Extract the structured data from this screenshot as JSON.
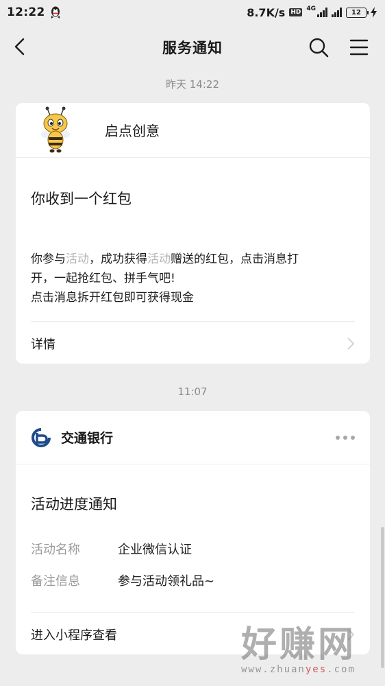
{
  "status_bar": {
    "time": "12:22",
    "network_speed": "8.7K/s",
    "hd_badge": "HD",
    "network_type": "4G",
    "battery_level": "12"
  },
  "nav": {
    "title": "服务通知",
    "back_icon": "chevron-left-icon",
    "search_icon": "search-icon",
    "menu_icon": "menu-icon"
  },
  "timestamps": [
    "昨天 14:22",
    "11:07"
  ],
  "cards": [
    {
      "brand": "启点创意",
      "avatar_icon": "bee-mascot-icon",
      "title": "你收到一个红包",
      "body": {
        "line1_a": "你参与",
        "line1_hl1": "活动",
        "line1_b": "，成功获得",
        "line1_hl2": "活动",
        "line1_c": "赠送的红包，点击消息打",
        "line2": "开，一起抢红包、拼手气吧!",
        "line3": "点击消息拆开红包即可获得现金"
      },
      "footer_label": "详情"
    },
    {
      "brand": "交通银行",
      "avatar_icon": "bocom-logo-icon",
      "title": "活动进度通知",
      "fields": [
        {
          "key": "活动名称",
          "value": "企业微信认证"
        },
        {
          "key": "备注信息",
          "value": "参与活动领礼品~"
        }
      ],
      "footer_label": "进入小程序查看"
    }
  ],
  "watermark": {
    "text": "好赚网",
    "url_a": "www.zhuan",
    "url_b": "yes",
    "url_c": ".com"
  },
  "colors": {
    "background": "#ededed",
    "card": "#ffffff",
    "muted_text": "#8c8c8c",
    "highlight_text": "#b3b3b3"
  }
}
